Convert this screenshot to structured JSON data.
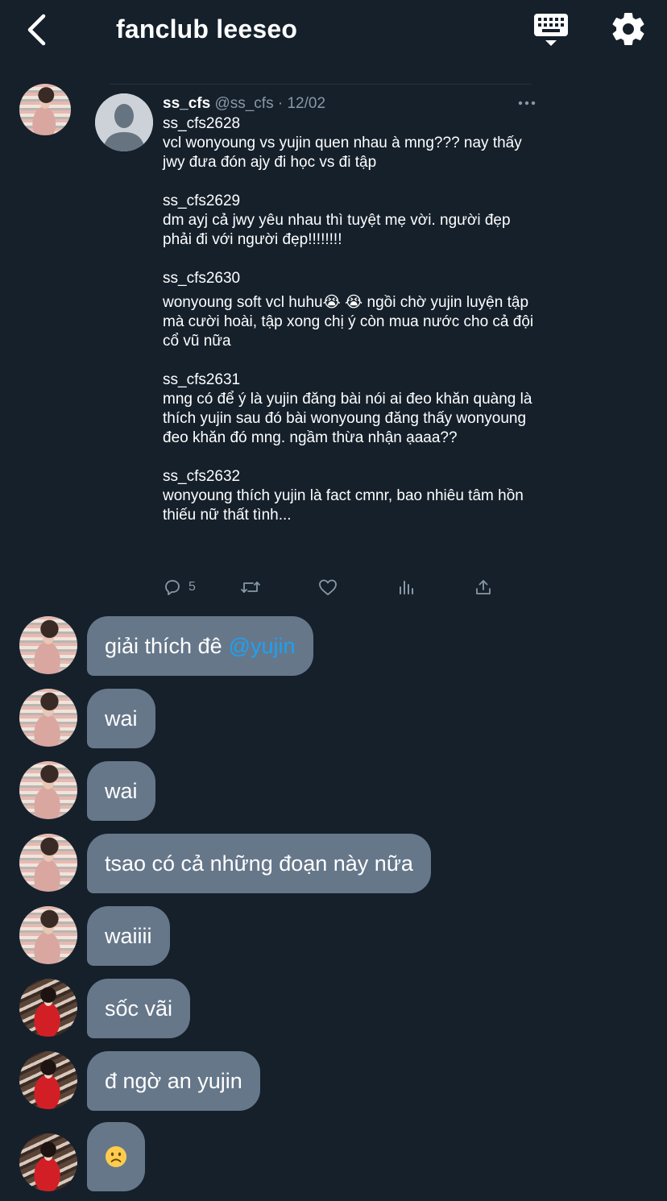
{
  "header": {
    "title": "fanclub leeseo",
    "back_icon": "chevron-left-icon",
    "keyboard_icon": "keyboard-icon",
    "settings_icon": "gear-icon"
  },
  "quoted_tweet": {
    "name": "ss_cfs",
    "handle": "@ss_cfs",
    "date": "· 12/02",
    "more_icon": "more-icon",
    "posts": [
      {
        "label": "ss_cfs2628",
        "text": "vcl wonyoung vs yujin quen nhau à mng??? nay thấy jwy đưa đón ajy đi học vs đi tập"
      },
      {
        "label": "ss_cfs2629",
        "text": "dm ayj cả jwy yêu nhau thì tuyệt mẹ vời. người đẹp phải đi với người đẹp!!!!!!!!"
      },
      {
        "label": "ss_cfs2630",
        "text": "wonyoung soft vcl huhu😭 😭 ngồi chờ yujin luyện tập mà cười hoài, tập xong chị ý còn mua nước cho cả đội cổ vũ nữa"
      },
      {
        "label": "ss_cfs2631",
        "text": "mng có để ý là yujin đăng bài nói ai đeo khăn quàng là thích yujin sau đó bài wonyoung đăng thấy wonyoung đeo khăn đó mng. ngầm thừa nhận ạaaa??"
      },
      {
        "label": "ss_cfs2632",
        "text": "wonyoung thích yujin là fact cmnr, bao nhiêu tâm hồn thiếu nữ thất tình..."
      }
    ],
    "actions": {
      "reply_count": "5",
      "reply_icon": "reply-icon",
      "retweet_icon": "retweet-icon",
      "like_icon": "heart-icon",
      "stats_icon": "bar-chart-icon",
      "share_icon": "share-icon"
    }
  },
  "messages": [
    {
      "text": "giải thích đê",
      "mention": "@yujin"
    },
    {
      "text": "wai"
    },
    {
      "text": "wai"
    },
    {
      "text": "tsao có cả những đoạn này nữa"
    },
    {
      "text": "waiiii"
    },
    {
      "text": "sốc vãi"
    },
    {
      "text": "đ ngờ an yujin"
    },
    {
      "emoji": "frowning-face-emoji"
    }
  ],
  "colors": {
    "background": "#15202b",
    "bubble": "#66778a",
    "muted": "#8899a6",
    "mention": "#1da1f2"
  }
}
